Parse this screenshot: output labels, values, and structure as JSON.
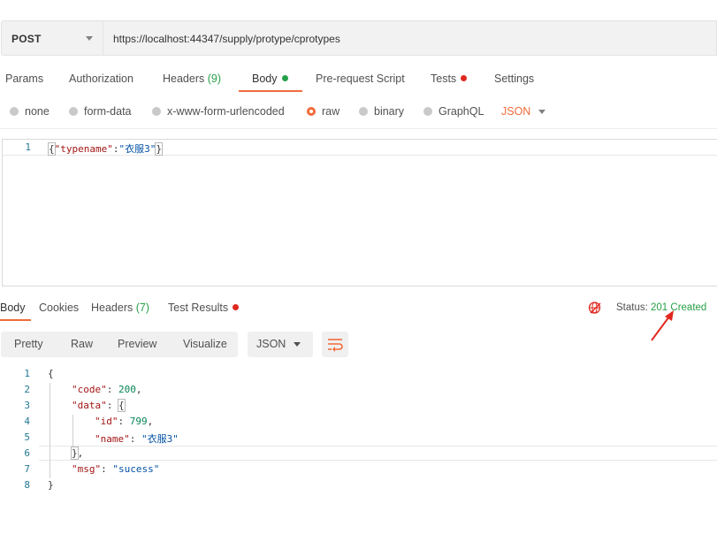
{
  "request": {
    "method": "POST",
    "url": "https://localhost:44347/supply/protype/cprotypes"
  },
  "request_tabs": {
    "params": "Params",
    "authorization": "Authorization",
    "headers": "Headers",
    "headers_count": "(9)",
    "body": "Body",
    "prerequest": "Pre-request Script",
    "tests": "Tests",
    "settings": "Settings"
  },
  "body_modes": {
    "none": "none",
    "form_data": "form-data",
    "urlencoded": "x-www-form-urlencoded",
    "raw": "raw",
    "binary": "binary",
    "graphql": "GraphQL",
    "format": "JSON",
    "selected": "raw"
  },
  "editor": {
    "line_numbers": [
      "1"
    ],
    "body_key": "\"typename\"",
    "body_value": "\"衣服3\""
  },
  "response_tabs": {
    "body": "Body",
    "cookies": "Cookies",
    "headers": "Headers",
    "headers_count": "(7)",
    "test_results": "Test Results"
  },
  "status": {
    "label": "Status:",
    "value": "201 Created"
  },
  "response_view": {
    "pretty": "Pretty",
    "raw": "Raw",
    "preview": "Preview",
    "visualize": "Visualize",
    "format": "JSON"
  },
  "response": {
    "line_numbers": [
      "1",
      "2",
      "3",
      "4",
      "5",
      "6",
      "7",
      "8"
    ],
    "code_key": "\"code\"",
    "code_value": "200",
    "data_key": "\"data\"",
    "id_key": "\"id\"",
    "id_value": "799",
    "name_key": "\"name\"",
    "name_value": "\"衣服3\"",
    "msg_key": "\"msg\"",
    "msg_value": "\"sucess\""
  },
  "colors": {
    "accent": "#f26b3a",
    "success": "#26a048",
    "error": "#e0281f"
  },
  "icons": [
    "chevron-down-icon",
    "globe-error-icon",
    "wrap-lines-icon",
    "red-arrow-annotation"
  ]
}
